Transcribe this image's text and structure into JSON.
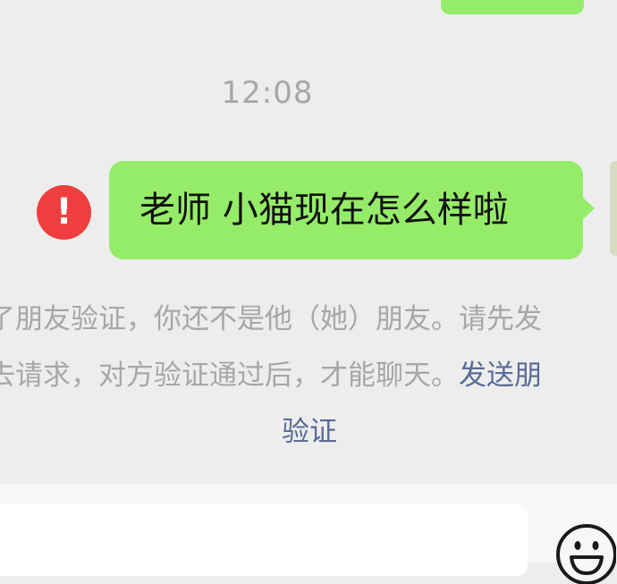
{
  "chat": {
    "timestamp": "12:08",
    "message": "老师 小猫现在怎么样啦",
    "error_icon_glyph": "!",
    "notice": {
      "line1": "了朋友验证，你还不是他（她）朋友。请先发",
      "line2_prefix": "去请求，对方验证通过后，才能聊天。",
      "line2_link": "发送朋",
      "line3_link": "验证"
    }
  },
  "colors": {
    "bubble": "#95ec69",
    "error": "#f03d3d",
    "link": "#576b95",
    "system_text": "#a7a7a7"
  },
  "icons": {
    "error": "exclamation-circle-icon",
    "emoji": "smiley-face-icon"
  }
}
